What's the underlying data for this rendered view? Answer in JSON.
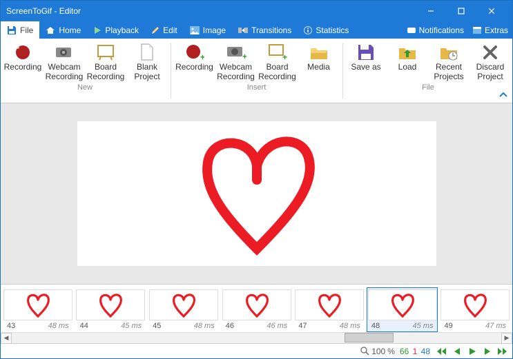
{
  "title": "ScreenToGif - Editor",
  "menu": {
    "file": "File",
    "home": "Home",
    "playback": "Playback",
    "edit": "Edit",
    "image": "Image",
    "transitions": "Transitions",
    "statistics": "Statistics",
    "notifications": "Notifications",
    "extras": "Extras"
  },
  "ribbon": {
    "groups": {
      "new": "New",
      "insert": "Insert",
      "file": "File"
    },
    "recording": "Recording",
    "webcam1": "Webcam",
    "webcam2": "Recording",
    "board1": "Board",
    "board2": "Recording",
    "blank1": "Blank",
    "blank2": "Project",
    "media": "Media",
    "saveas": "Save as",
    "load": "Load",
    "recent1": "Recent",
    "recent2": "Projects",
    "discard1": "Discard",
    "discard2": "Project"
  },
  "frames": [
    {
      "n": "43",
      "d": "48 ms"
    },
    {
      "n": "44",
      "d": "45 ms"
    },
    {
      "n": "45",
      "d": "48 ms"
    },
    {
      "n": "46",
      "d": "46 ms"
    },
    {
      "n": "47",
      "d": "48 ms"
    },
    {
      "n": "48",
      "d": "45 ms"
    },
    {
      "n": "49",
      "d": "47 ms"
    }
  ],
  "status": {
    "zoom_value": "100",
    "zoom_sym": "%",
    "count_a": "66",
    "count_b": "1",
    "count_c": "48"
  }
}
